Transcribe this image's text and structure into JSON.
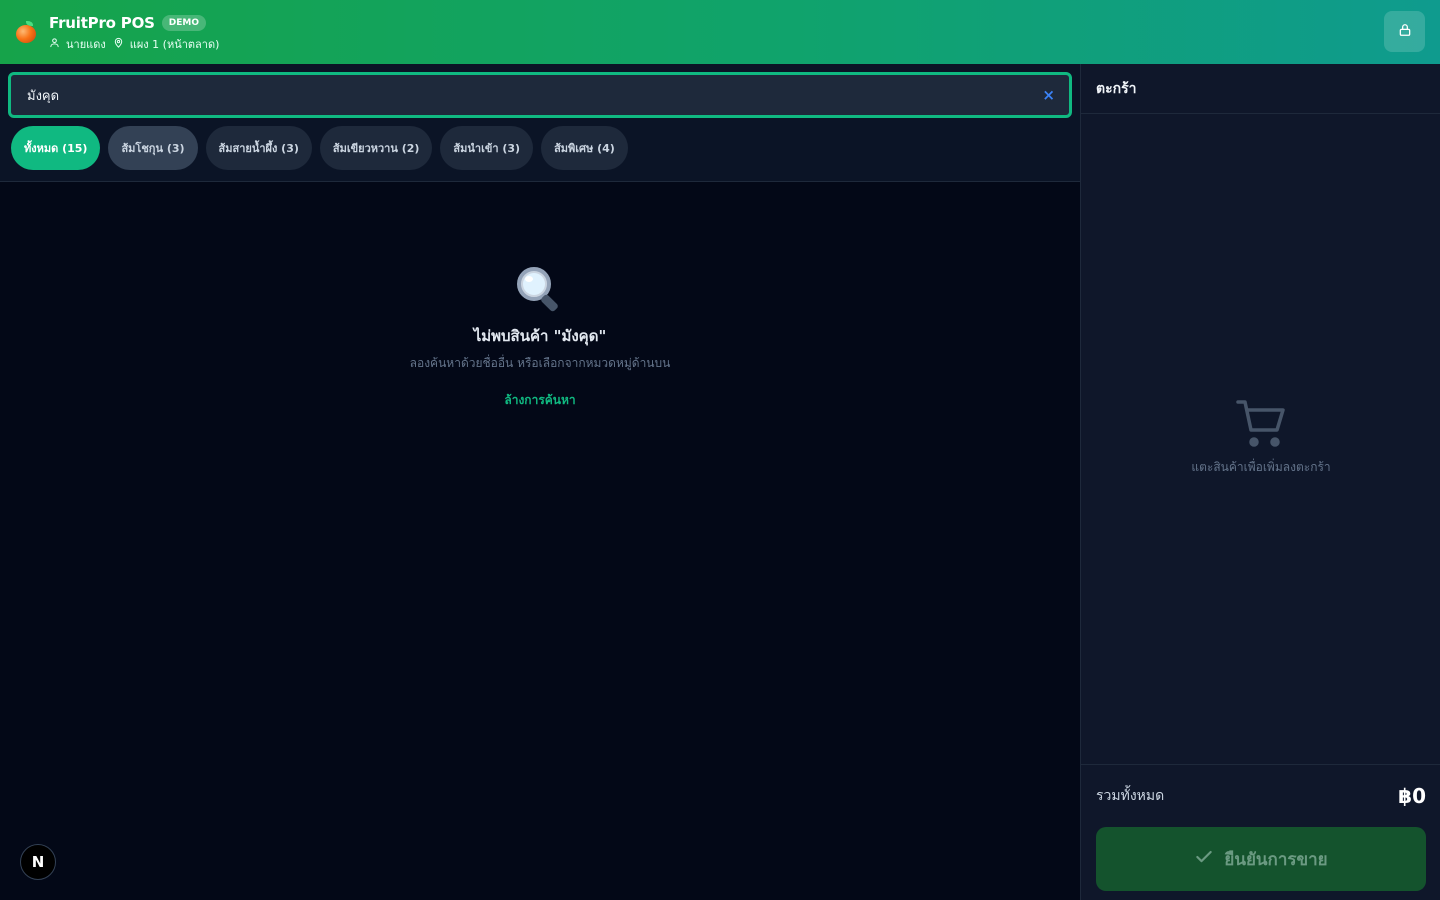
{
  "header": {
    "app_title": "FruitPro POS",
    "badge": "DEMO",
    "user_name": "นายแดง",
    "stall_name": "แผง 1 (หน้าตลาด)"
  },
  "search": {
    "value": "มังคุด",
    "clear_symbol": "×"
  },
  "categories": [
    {
      "label": "ทั้งหมด (15)",
      "active": true
    },
    {
      "label": "ส้มโชกุน (3)",
      "active": false
    },
    {
      "label": "ส้มสายน้ำผึ้ง (3)",
      "active": false
    },
    {
      "label": "ส้มเขียวหวาน (2)",
      "active": false
    },
    {
      "label": "ส้มนำเข้า (3)",
      "active": false
    },
    {
      "label": "ส้มพิเศษ (4)",
      "active": false
    }
  ],
  "empty_state": {
    "title": "ไม่พบสินค้า \"มังคุด\"",
    "subtitle": "ลองค้นหาด้วยชื่ออื่น หรือเลือกจากหมวดหมู่ด้านบน",
    "action": "ล้างการค้นหา"
  },
  "cart": {
    "title": "ตะกร้า",
    "empty_text": "แตะสินค้าเพื่อเพิ่มลงตะกร้า",
    "total_label": "รวมทั้งหมด",
    "total_value": "฿0",
    "confirm_label": "ยืนยันการขาย"
  },
  "dev_badge": "N",
  "colors": {
    "accent": "#10b981",
    "header_start": "#16a34a",
    "header_end": "#0f9b8e",
    "background": "#030817",
    "panel": "#0f172a"
  }
}
